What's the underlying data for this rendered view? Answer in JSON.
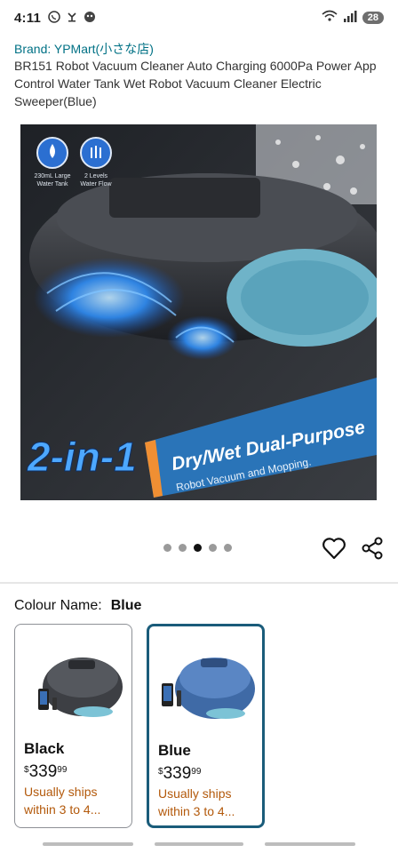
{
  "status": {
    "time": "4:11",
    "battery": "28"
  },
  "product": {
    "brand": "Brand: YPMart(小さな店)",
    "title": "BR151 Robot Vacuum Cleaner Auto Charging 6000Pa Power App Control Water Tank Wet Robot Vacuum Cleaner Electric Sweeper(Blue)"
  },
  "image": {
    "badge1": [
      "230mL Large",
      "Water Tank"
    ],
    "badge2": [
      "2 Levels",
      "Water Flow"
    ],
    "big_text": "2-in-1",
    "banner_title": "Dry/Wet Dual-Purpose",
    "banner_sub": "Robot Vacuum and Mopping."
  },
  "carousel": {
    "total": 5,
    "active_index": 2
  },
  "colour": {
    "label": "Colour Name:",
    "value": "Blue"
  },
  "swatches": [
    {
      "name": "Black",
      "currency": "$",
      "whole": "339",
      "fraction": "99",
      "shipping": "Usually ships within 3 to 4...",
      "selected": false
    },
    {
      "name": "Blue",
      "currency": "$",
      "whole": "339",
      "fraction": "99",
      "shipping": "Usually ships within 3 to 4...",
      "selected": true
    }
  ],
  "colors": {
    "link": "#007185",
    "shipping": "#b3590b",
    "selected_border": "#1a5c7a",
    "banner_blue": "#2a74b8"
  },
  "icons": [
    "whatsapp-icon",
    "notification-icon",
    "app-icon",
    "wifi-icon",
    "signal-icon",
    "battery-icon",
    "heart-icon",
    "share-icon"
  ]
}
